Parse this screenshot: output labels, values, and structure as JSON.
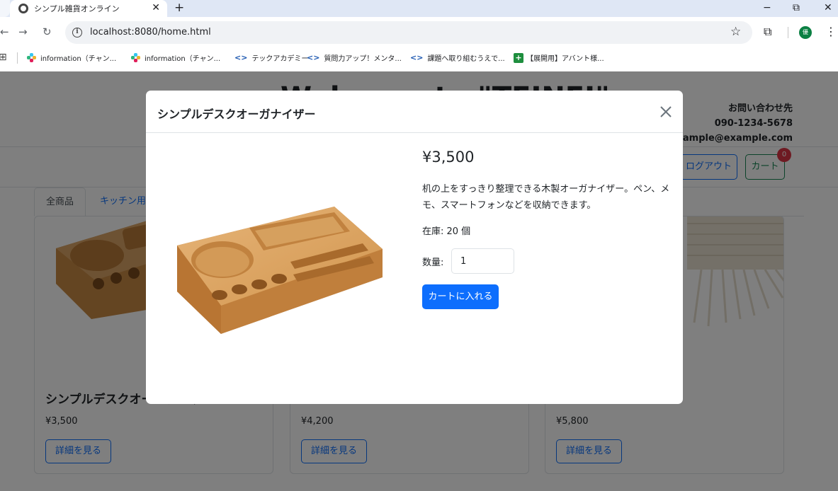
{
  "browser": {
    "tab_title": "シンプル雑貨オンライン",
    "tab_close": "✕",
    "new_tab": "+",
    "window_min": "−",
    "window_restore": "⧉",
    "window_close": "✕",
    "url": "localhost:8080/home.html",
    "profile_initial": "優",
    "bookmarks": [
      {
        "label": "information（チャン...",
        "icon": "slack-icon"
      },
      {
        "label": "information（チャン...",
        "icon": "slack-icon"
      },
      {
        "label": "テックアカデミー",
        "icon": "code-icon"
      },
      {
        "label": "質問力アップ！メンタ...",
        "icon": "code-icon"
      },
      {
        "label": "課題へ取り組むうえで...",
        "icon": "code-icon"
      },
      {
        "label": "【展開用】アバント様...",
        "icon": "sheets-icon"
      }
    ]
  },
  "page": {
    "welcome": "Welcome to \"TEINEI\"",
    "contact": {
      "title": "お問い合わせ先",
      "phone": "090-1234-5678",
      "email": "sample@example.com"
    },
    "logout_label": "ログアウト",
    "cart_label": "カート",
    "cart_count": "0",
    "tabs": [
      "全商品",
      "キッチン用品"
    ],
    "products": [
      {
        "name": "シンプルデスクオーガナイザー",
        "price": "¥3,500",
        "button": "詳細を見る"
      },
      {
        "name": "",
        "price": "¥4,200",
        "button": "詳細を見る"
      },
      {
        "name": "",
        "price": "¥5,800",
        "button": "詳細を見る"
      }
    ]
  },
  "modal": {
    "title": "シンプルデスクオーガナイザー",
    "price": "¥3,500",
    "description": "机の上をすっきり整理できる木製オーガナイザー。ペン、メモ、スマートフォンなどを収納できます。",
    "stock": "在庫: 20 個",
    "quantity_label": "数量:",
    "quantity_value": "1",
    "add_to_cart": "カートに入れる"
  },
  "colors": {
    "primary": "#0d6efd",
    "success": "#198754",
    "danger": "#dc3545",
    "wood": "#d9a05e"
  }
}
